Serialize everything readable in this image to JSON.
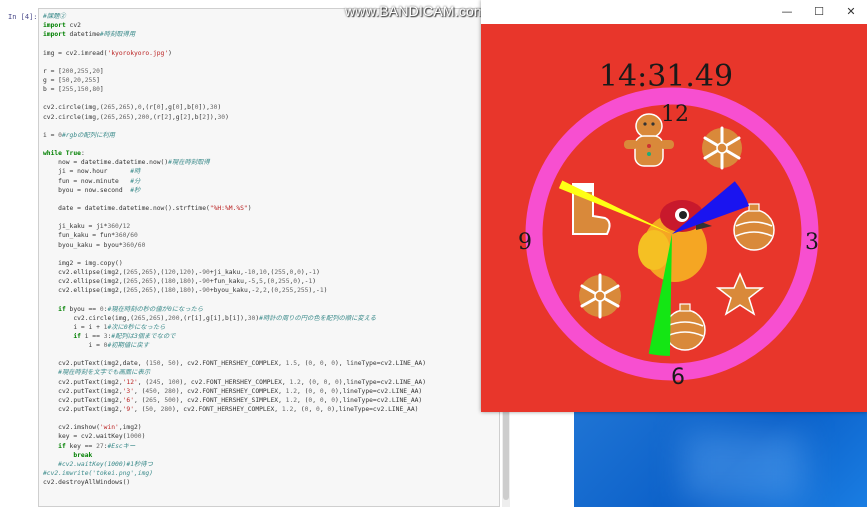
{
  "notebook": {
    "prompt": "In [4]:",
    "code_lines": [
      [
        {
          "t": "#課題②",
          "c": "cm"
        }
      ],
      [
        {
          "t": "import",
          "c": "kw"
        },
        {
          "t": " cv2"
        }
      ],
      [
        {
          "t": "import",
          "c": "kw"
        },
        {
          "t": " datetime"
        },
        {
          "t": "#時刻取得用",
          "c": "cm"
        }
      ],
      [],
      [
        {
          "t": "img = cv2.imread("
        },
        {
          "t": "'kyorokyoro.jpg'",
          "c": "st"
        },
        {
          "t": ")"
        }
      ],
      [],
      [
        {
          "t": "r = ["
        },
        {
          "t": "200",
          "c": "nm"
        },
        {
          "t": ","
        },
        {
          "t": "255",
          "c": "nm"
        },
        {
          "t": ","
        },
        {
          "t": "20",
          "c": "nm"
        },
        {
          "t": "]"
        }
      ],
      [
        {
          "t": "g = ["
        },
        {
          "t": "50",
          "c": "nm"
        },
        {
          "t": ","
        },
        {
          "t": "20",
          "c": "nm"
        },
        {
          "t": ","
        },
        {
          "t": "255",
          "c": "nm"
        },
        {
          "t": "]"
        }
      ],
      [
        {
          "t": "b = ["
        },
        {
          "t": "255",
          "c": "nm"
        },
        {
          "t": ","
        },
        {
          "t": "150",
          "c": "nm"
        },
        {
          "t": ","
        },
        {
          "t": "80",
          "c": "nm"
        },
        {
          "t": "]"
        }
      ],
      [],
      [
        {
          "t": "cv2.circle(img,("
        },
        {
          "t": "265",
          "c": "nm"
        },
        {
          "t": ","
        },
        {
          "t": "265",
          "c": "nm"
        },
        {
          "t": "),"
        },
        {
          "t": "0",
          "c": "nm"
        },
        {
          "t": ",(r["
        },
        {
          "t": "0",
          "c": "nm"
        },
        {
          "t": "],g["
        },
        {
          "t": "0",
          "c": "nm"
        },
        {
          "t": "],b["
        },
        {
          "t": "0",
          "c": "nm"
        },
        {
          "t": "]),"
        },
        {
          "t": "30",
          "c": "nm"
        },
        {
          "t": ")"
        }
      ],
      [
        {
          "t": "cv2.circle(img,("
        },
        {
          "t": "265",
          "c": "nm"
        },
        {
          "t": ","
        },
        {
          "t": "265",
          "c": "nm"
        },
        {
          "t": "),"
        },
        {
          "t": "200",
          "c": "nm"
        },
        {
          "t": ",(r["
        },
        {
          "t": "2",
          "c": "nm"
        },
        {
          "t": "],g["
        },
        {
          "t": "2",
          "c": "nm"
        },
        {
          "t": "],b["
        },
        {
          "t": "2",
          "c": "nm"
        },
        {
          "t": "]),"
        },
        {
          "t": "30",
          "c": "nm"
        },
        {
          "t": ")"
        }
      ],
      [],
      [
        {
          "t": "i = "
        },
        {
          "t": "0",
          "c": "nm"
        },
        {
          "t": "#rgbの配列に利用",
          "c": "cm"
        }
      ],
      [],
      [
        {
          "t": "while",
          "c": "kw"
        },
        {
          "t": " "
        },
        {
          "t": "True",
          "c": "kw"
        },
        {
          "t": ":"
        }
      ],
      [
        {
          "t": "    now = datetime.datetime.now()"
        },
        {
          "t": "#現在時刻取得",
          "c": "cm"
        }
      ],
      [
        {
          "t": "    ji = now.hour      "
        },
        {
          "t": "#時",
          "c": "cm"
        }
      ],
      [
        {
          "t": "    fun = now.minute   "
        },
        {
          "t": "#分",
          "c": "cm"
        }
      ],
      [
        {
          "t": "    byou = now.second  "
        },
        {
          "t": "#秒",
          "c": "cm"
        }
      ],
      [],
      [
        {
          "t": "    date = datetime.datetime.now().strftime("
        },
        {
          "t": "\"%H:%M.%S\"",
          "c": "st"
        },
        {
          "t": ")"
        }
      ],
      [],
      [
        {
          "t": "    ji_kaku = ji*"
        },
        {
          "t": "360",
          "c": "nm"
        },
        {
          "t": "/"
        },
        {
          "t": "12",
          "c": "nm"
        }
      ],
      [
        {
          "t": "    fun_kaku = fun*"
        },
        {
          "t": "360",
          "c": "nm"
        },
        {
          "t": "/"
        },
        {
          "t": "60",
          "c": "nm"
        }
      ],
      [
        {
          "t": "    byou_kaku = byou*"
        },
        {
          "t": "360",
          "c": "nm"
        },
        {
          "t": "/"
        },
        {
          "t": "60",
          "c": "nm"
        }
      ],
      [],
      [
        {
          "t": "    img2 = img.copy()"
        }
      ],
      [
        {
          "t": "    cv2.ellipse(img2,("
        },
        {
          "t": "265",
          "c": "nm"
        },
        {
          "t": ","
        },
        {
          "t": "265",
          "c": "nm"
        },
        {
          "t": "),("
        },
        {
          "t": "120",
          "c": "nm"
        },
        {
          "t": ","
        },
        {
          "t": "120",
          "c": "nm"
        },
        {
          "t": "),-"
        },
        {
          "t": "90",
          "c": "nm"
        },
        {
          "t": "+ji_kaku,-"
        },
        {
          "t": "10",
          "c": "nm"
        },
        {
          "t": ","
        },
        {
          "t": "10",
          "c": "nm"
        },
        {
          "t": ",("
        },
        {
          "t": "255",
          "c": "nm"
        },
        {
          "t": ","
        },
        {
          "t": "0",
          "c": "nm"
        },
        {
          "t": ","
        },
        {
          "t": "0",
          "c": "nm"
        },
        {
          "t": "),-"
        },
        {
          "t": "1",
          "c": "nm"
        },
        {
          "t": ")"
        }
      ],
      [
        {
          "t": "    cv2.ellipse(img2,("
        },
        {
          "t": "265",
          "c": "nm"
        },
        {
          "t": ","
        },
        {
          "t": "265",
          "c": "nm"
        },
        {
          "t": "),("
        },
        {
          "t": "180",
          "c": "nm"
        },
        {
          "t": ","
        },
        {
          "t": "180",
          "c": "nm"
        },
        {
          "t": "),-"
        },
        {
          "t": "90",
          "c": "nm"
        },
        {
          "t": "+fun_kaku,-"
        },
        {
          "t": "5",
          "c": "nm"
        },
        {
          "t": ","
        },
        {
          "t": "5",
          "c": "nm"
        },
        {
          "t": ",("
        },
        {
          "t": "0",
          "c": "nm"
        },
        {
          "t": ","
        },
        {
          "t": "255",
          "c": "nm"
        },
        {
          "t": ","
        },
        {
          "t": "0",
          "c": "nm"
        },
        {
          "t": "),-"
        },
        {
          "t": "1",
          "c": "nm"
        },
        {
          "t": ")"
        }
      ],
      [
        {
          "t": "    cv2.ellipse(img2,("
        },
        {
          "t": "265",
          "c": "nm"
        },
        {
          "t": ","
        },
        {
          "t": "265",
          "c": "nm"
        },
        {
          "t": "),("
        },
        {
          "t": "180",
          "c": "nm"
        },
        {
          "t": ","
        },
        {
          "t": "180",
          "c": "nm"
        },
        {
          "t": "),-"
        },
        {
          "t": "90",
          "c": "nm"
        },
        {
          "t": "+byou_kaku,-"
        },
        {
          "t": "2",
          "c": "nm"
        },
        {
          "t": ","
        },
        {
          "t": "2",
          "c": "nm"
        },
        {
          "t": ",("
        },
        {
          "t": "0",
          "c": "nm"
        },
        {
          "t": ","
        },
        {
          "t": "255",
          "c": "nm"
        },
        {
          "t": ","
        },
        {
          "t": "255",
          "c": "nm"
        },
        {
          "t": "),-"
        },
        {
          "t": "1",
          "c": "nm"
        },
        {
          "t": ")"
        }
      ],
      [],
      [
        {
          "t": "    "
        },
        {
          "t": "if",
          "c": "kw"
        },
        {
          "t": " byou == "
        },
        {
          "t": "0",
          "c": "nm"
        },
        {
          "t": ":"
        },
        {
          "t": "#現在時刻の秒の値が0になったら",
          "c": "cm"
        }
      ],
      [
        {
          "t": "        cv2.circle(img,("
        },
        {
          "t": "265",
          "c": "nm"
        },
        {
          "t": ","
        },
        {
          "t": "265",
          "c": "nm"
        },
        {
          "t": "),"
        },
        {
          "t": "200",
          "c": "nm"
        },
        {
          "t": ",(r[i],g[i],b[i]),"
        },
        {
          "t": "30",
          "c": "nm"
        },
        {
          "t": ")"
        },
        {
          "t": "#時計の周りの円の色を配列の順に変える",
          "c": "cm"
        }
      ],
      [
        {
          "t": "        i = i + "
        },
        {
          "t": "1",
          "c": "nm"
        },
        {
          "t": "#次に0秒になったら",
          "c": "cm"
        }
      ],
      [
        {
          "t": "        "
        },
        {
          "t": "if",
          "c": "kw"
        },
        {
          "t": " i == "
        },
        {
          "t": "3",
          "c": "nm"
        },
        {
          "t": ":"
        },
        {
          "t": "#配列は3個までなので",
          "c": "cm"
        }
      ],
      [
        {
          "t": "            i = "
        },
        {
          "t": "0",
          "c": "nm"
        },
        {
          "t": "#初期値に戻す",
          "c": "cm"
        }
      ],
      [],
      [
        {
          "t": "    cv2.putText(img2,date, ("
        },
        {
          "t": "150",
          "c": "nm"
        },
        {
          "t": ", "
        },
        {
          "t": "50",
          "c": "nm"
        },
        {
          "t": "), cv2.FONT_HERSHEY_COMPLEX, "
        },
        {
          "t": "1.5",
          "c": "nm"
        },
        {
          "t": ", ("
        },
        {
          "t": "0",
          "c": "nm"
        },
        {
          "t": ", "
        },
        {
          "t": "0",
          "c": "nm"
        },
        {
          "t": ", "
        },
        {
          "t": "0",
          "c": "nm"
        },
        {
          "t": "), lineType=cv2.LINE_AA)"
        }
      ],
      [
        {
          "t": "    "
        },
        {
          "t": "#現在時刻を文字でも画面に表示",
          "c": "cm"
        }
      ],
      [
        {
          "t": "    cv2.putText(img2,"
        },
        {
          "t": "'12'",
          "c": "st"
        },
        {
          "t": ", ("
        },
        {
          "t": "245",
          "c": "nm"
        },
        {
          "t": ", "
        },
        {
          "t": "100",
          "c": "nm"
        },
        {
          "t": "), cv2.FONT_HERSHEY_COMPLEX, "
        },
        {
          "t": "1.2",
          "c": "nm"
        },
        {
          "t": ", ("
        },
        {
          "t": "0",
          "c": "nm"
        },
        {
          "t": ", "
        },
        {
          "t": "0",
          "c": "nm"
        },
        {
          "t": ", "
        },
        {
          "t": "0",
          "c": "nm"
        },
        {
          "t": "),lineType=cv2.LINE_AA)"
        }
      ],
      [
        {
          "t": "    cv2.putText(img2,"
        },
        {
          "t": "'3'",
          "c": "st"
        },
        {
          "t": ", ("
        },
        {
          "t": "450",
          "c": "nm"
        },
        {
          "t": ", "
        },
        {
          "t": "280",
          "c": "nm"
        },
        {
          "t": "), cv2.FONT_HERSHEY_COMPLEX, "
        },
        {
          "t": "1.2",
          "c": "nm"
        },
        {
          "t": ", ("
        },
        {
          "t": "0",
          "c": "nm"
        },
        {
          "t": ", "
        },
        {
          "t": "0",
          "c": "nm"
        },
        {
          "t": ", "
        },
        {
          "t": "0",
          "c": "nm"
        },
        {
          "t": "),lineType=cv2.LINE_AA)"
        }
      ],
      [
        {
          "t": "    cv2.putText(img2,"
        },
        {
          "t": "'6'",
          "c": "st"
        },
        {
          "t": ", ("
        },
        {
          "t": "265",
          "c": "nm"
        },
        {
          "t": ", "
        },
        {
          "t": "500",
          "c": "nm"
        },
        {
          "t": "), cv2.FONT_HERSHEY_SIMPLEX, "
        },
        {
          "t": "1.2",
          "c": "nm"
        },
        {
          "t": ", ("
        },
        {
          "t": "0",
          "c": "nm"
        },
        {
          "t": ", "
        },
        {
          "t": "0",
          "c": "nm"
        },
        {
          "t": ", "
        },
        {
          "t": "0",
          "c": "nm"
        },
        {
          "t": "),lineType=cv2.LINE_AA)"
        }
      ],
      [
        {
          "t": "    cv2.putText(img2,"
        },
        {
          "t": "'9'",
          "c": "st"
        },
        {
          "t": ", ("
        },
        {
          "t": "50",
          "c": "nm"
        },
        {
          "t": ", "
        },
        {
          "t": "280",
          "c": "nm"
        },
        {
          "t": "), cv2.FONT_HERSHEY_COMPLEX, "
        },
        {
          "t": "1.2",
          "c": "nm"
        },
        {
          "t": ", ("
        },
        {
          "t": "0",
          "c": "nm"
        },
        {
          "t": ", "
        },
        {
          "t": "0",
          "c": "nm"
        },
        {
          "t": ", "
        },
        {
          "t": "0",
          "c": "nm"
        },
        {
          "t": "),lineType=cv2.LINE_AA)"
        }
      ],
      [],
      [
        {
          "t": "    cv2.imshow("
        },
        {
          "t": "'win'",
          "c": "st"
        },
        {
          "t": ",img2)"
        }
      ],
      [
        {
          "t": "    key = cv2.waitKey("
        },
        {
          "t": "1000",
          "c": "nm"
        },
        {
          "t": ")"
        }
      ],
      [
        {
          "t": "    "
        },
        {
          "t": "if",
          "c": "kw"
        },
        {
          "t": " key == "
        },
        {
          "t": "27",
          "c": "nm"
        },
        {
          "t": ":"
        },
        {
          "t": "#Escキー",
          "c": "cm"
        }
      ],
      [
        {
          "t": "        "
        },
        {
          "t": "break",
          "c": "kw"
        }
      ],
      [
        {
          "t": "    "
        },
        {
          "t": "#cv2.waitKey(1000)#1秒待つ",
          "c": "cm"
        }
      ],
      [
        {
          "t": "#cv2.imwrite('tokei.png',img)",
          "c": "cm"
        }
      ],
      [
        {
          "t": "cv2.destroyAllWindows()"
        }
      ]
    ]
  },
  "watermark": "www.BANDICAM.com",
  "window": {
    "minimize_icon": "minimize-icon",
    "maximize_icon": "maximize-icon",
    "close_icon": "close-icon",
    "minimize_glyph": "—",
    "maximize_glyph": "☐",
    "close_glyph": "✕"
  },
  "clock": {
    "time_text": "14:31.49",
    "label_12": "12",
    "label_3": "3",
    "label_6": "6",
    "label_9": "9",
    "hour": 14,
    "minute": 31,
    "second": 49,
    "colors": {
      "background": "#e8362b",
      "ring": "#f74fd0",
      "hour_hand": "#1a14f0",
      "minute_hand": "#14e614",
      "second_hand": "#ffff14",
      "text": "#1a1a1a"
    }
  },
  "colors": {
    "code_bg": "#f7f7f7",
    "keyword": "#008000",
    "comment": "#3a8a8a",
    "string": "#ba2121",
    "number": "#666666",
    "desktop": "#0a5fc8"
  }
}
